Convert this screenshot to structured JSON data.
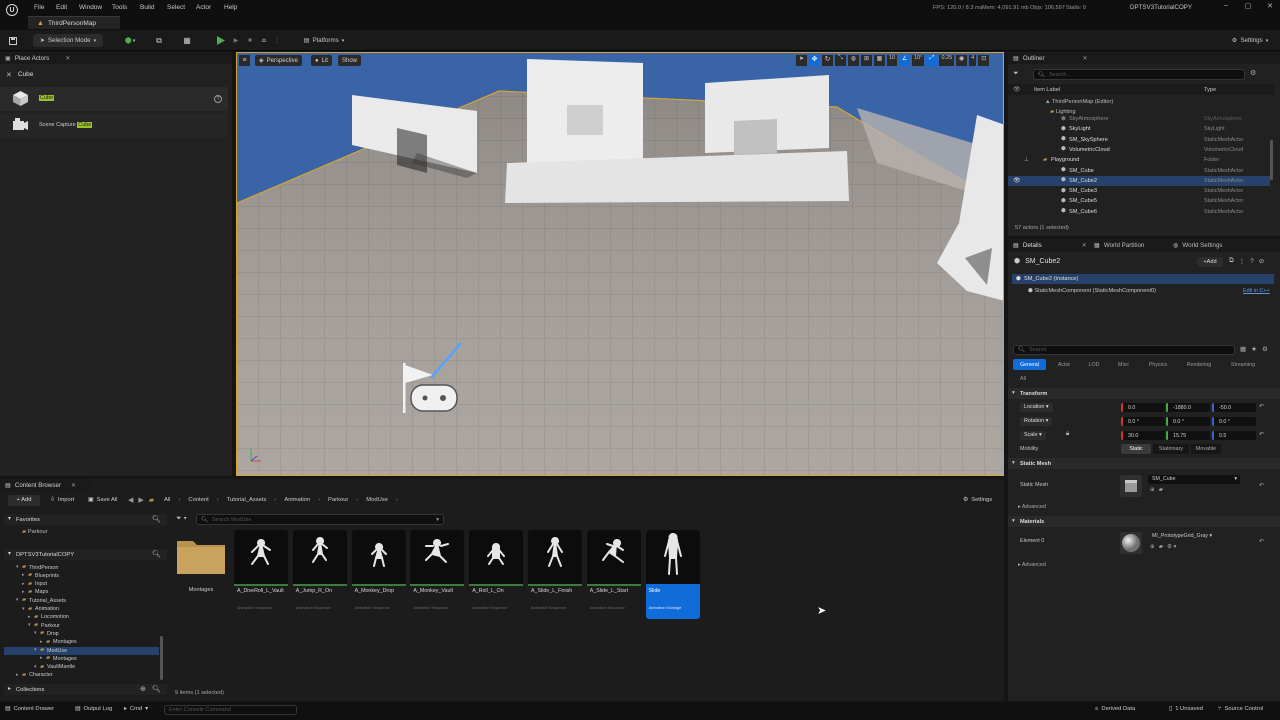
{
  "app": {
    "logo": "U",
    "project": "DPTSV3TutorialCOPY"
  },
  "menu": [
    "File",
    "Edit",
    "Window",
    "Tools",
    "Build",
    "Select",
    "Actor",
    "Help"
  ],
  "map_tab": "ThirdPersonMap",
  "stats": {
    "fps": "FPS: 120.0 / 8.3 ms",
    "mem": "Mem: 4,091.91 mb",
    "objs": "Objs: 106,597",
    "stalls": "Stalls: 0"
  },
  "window_controls": [
    "–",
    "▢",
    "✕"
  ],
  "toolbar": {
    "selection_mode": "Selection Mode",
    "platforms": "Platforms",
    "settings": "Settings"
  },
  "place_actors": {
    "title": "Place Actors",
    "search_value": "Cube",
    "results": [
      {
        "prefix": "",
        "match": "Cube"
      },
      {
        "prefix": "Scene Capture ",
        "match": "Cube"
      }
    ]
  },
  "viewport": {
    "perspective": "Perspective",
    "lit": "Lit",
    "show": "Show",
    "grid": "10",
    "angle": "10°",
    "scale": "0.25",
    "cam_speed": "4"
  },
  "outliner": {
    "title": "Outliner",
    "search_placeholder": "Search...",
    "col_label": "Item Label",
    "col_type": "Type",
    "rows": [
      {
        "label": "SkyAtmosphere",
        "type": "SkyAtmosphere",
        "indent": 5,
        "kind": "actor",
        "partial": true
      },
      {
        "label": "SkyLight",
        "type": "SkyLight",
        "indent": 5,
        "kind": "actor"
      },
      {
        "label": "SM_SkySphere",
        "type": "StaticMeshActor",
        "indent": 5,
        "kind": "actor"
      },
      {
        "label": "VolumetricCloud",
        "type": "VolumetricCloud",
        "indent": 5,
        "kind": "actor"
      },
      {
        "label": "Playground",
        "type": "Folder",
        "indent": 3,
        "kind": "folder"
      },
      {
        "label": "SM_Cube",
        "type": "StaticMeshActor",
        "indent": 5,
        "kind": "actor"
      },
      {
        "label": "SM_Cube2",
        "type": "StaticMeshActor",
        "indent": 5,
        "kind": "actor",
        "selected": true
      },
      {
        "label": "SM_Cube3",
        "type": "StaticMeshActor",
        "indent": 5,
        "kind": "actor"
      },
      {
        "label": "SM_Cube5",
        "type": "StaticMeshActor",
        "indent": 5,
        "kind": "actor"
      },
      {
        "label": "SM_Cube6",
        "type": "StaticMeshActor",
        "indent": 5,
        "kind": "actor"
      }
    ],
    "head_rows": [
      {
        "label": "ThirdPersonMap (Editor)"
      },
      {
        "label": "Lighting"
      }
    ],
    "footer": "57 actors (1 selected)"
  },
  "details": {
    "tabs": [
      "Details",
      "World Partition",
      "World Settings"
    ],
    "actor_name": "SM_Cube2",
    "add": "+Add",
    "instance": "SM_Cube2 (Instance)",
    "component": "StaticMeshComponent (StaticMeshComponent0)",
    "edit_cpp": "Edit in C++",
    "search_placeholder": "Search",
    "categories": [
      "General",
      "Actor",
      "LOD",
      "Misc",
      "Physics",
      "Rendering",
      "Streaming",
      "All"
    ],
    "transform_title": "Transform",
    "location": {
      "label": "Location",
      "x": "0.0",
      "y": "-1880.0",
      "z": "-50.0"
    },
    "rotation": {
      "label": "Rotation",
      "x": "0.0 °",
      "y": "0.0 °",
      "z": "0.0 °"
    },
    "scale": {
      "label": "Scale",
      "x": "30.0",
      "y": "15.75",
      "z": "0.5"
    },
    "mobility": {
      "label": "Mobility",
      "options": [
        "Static",
        "Stationary",
        "Movable"
      ]
    },
    "static_mesh_title": "Static Mesh",
    "static_mesh_label": "Static Mesh",
    "static_mesh_value": "SM_Cube",
    "advanced": "Advanced",
    "materials_title": "Materials",
    "element_label": "Element 0",
    "material_value": "MI_PrototypeGrid_Gray"
  },
  "content_browser": {
    "title": "Content Browser",
    "add": "+ Add",
    "import": "Import",
    "save_all": "Save All",
    "breadcrumb": [
      "All",
      "Content",
      "Tutorial_Assets",
      "Animation",
      "Parkour",
      "ModUse"
    ],
    "settings": "Settings",
    "favorites": "Favorites",
    "fav_items": [
      "Parkour"
    ],
    "project": "DPTSV3TutorialCOPY",
    "tree": [
      "ThirdPerson",
      "Blueprints",
      "Input",
      "Maps",
      "Tutorial_Assets",
      "Animation",
      "Locomotion",
      "Parkour",
      "Drop",
      "Montages",
      "ModUse",
      "Montages",
      "VaultMantle",
      "Character"
    ],
    "collections": "Collections",
    "search_placeholder": "Search ModUse",
    "assets": [
      {
        "name": "Montages",
        "type": ""
      },
      {
        "name": "A_DiveRoll_L_Vault",
        "type": "Animation Sequence"
      },
      {
        "name": "A_Jump_R_On",
        "type": "Animation Sequence"
      },
      {
        "name": "A_Monkey_Drop",
        "type": "Animation Sequence"
      },
      {
        "name": "A_Monkey_Vault",
        "type": "Animation Sequence"
      },
      {
        "name": "A_Roll_L_On",
        "type": "Animation Sequence"
      },
      {
        "name": "A_Slide_L_Finish",
        "type": "Animation Sequence"
      },
      {
        "name": "A_Slide_L_Start",
        "type": "Animation Sequence"
      },
      {
        "name": "Slide",
        "type": "Animation Montage"
      }
    ],
    "status": "9 items (1 selected)"
  },
  "statusbar": {
    "drawer": "Content Drawer",
    "output": "Output Log",
    "cmd": "Cmd",
    "console_placeholder": "Enter Console Command",
    "derived": "Derived Data",
    "unsaved": "1 Unsaved",
    "source": "Source Control"
  },
  "colors": {
    "accent": "#0f6cd9",
    "select": "#26416b",
    "folder": "#b8934e",
    "anim_bar": "#3b7c3b",
    "sky": "#3a64a8"
  }
}
